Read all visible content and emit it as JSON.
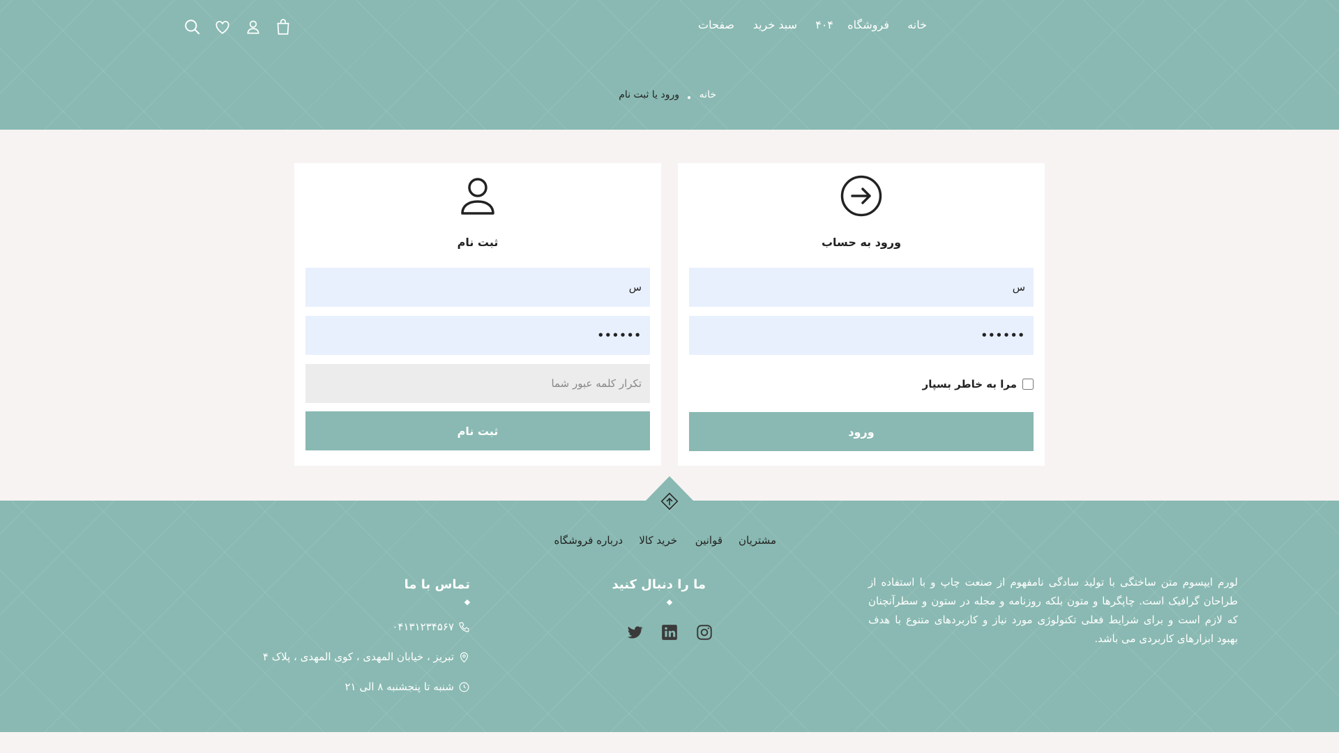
{
  "header": {
    "nav": [
      {
        "label": "خانه"
      },
      {
        "label": "فروشگاه"
      },
      {
        "label": "۴۰۴"
      },
      {
        "label": "سبد خرید"
      },
      {
        "label": "صفحات"
      }
    ],
    "icons": [
      "cart-icon",
      "user-icon",
      "heart-icon",
      "search-icon"
    ]
  },
  "breadcrumb": {
    "home": "خانه",
    "current": "ورود یا ثبت نام"
  },
  "login": {
    "title": "ورود به حساب",
    "username_value": "س",
    "password_value": "••••••",
    "remember_label": "مرا به خاطر بسپار",
    "submit_label": "ورود"
  },
  "register": {
    "title": "ثبت نام",
    "username_value": "س",
    "password_value": "••••••",
    "confirm_placeholder": "تکرار کلمه عبور شما",
    "submit_label": "ثبت نام"
  },
  "footer": {
    "links": [
      {
        "label": "مشتریان"
      },
      {
        "label": "قوانین"
      },
      {
        "label": "خرید کالا"
      },
      {
        "label": "درباره فروشگاه"
      }
    ],
    "about": "لورم ایپسوم متن ساختگی با تولید سادگی نامفهوم از صنعت چاپ و با استفاده از طراحان گرافیک است. چاپگرها و متون بلکه روزنامه و مجله در ستون و سطرآنچنان که لازم است و برای شرایط فعلی تکنولوژی مورد نیاز و کاربردهای متنوع با هدف بهبود ابزارهای کاربردی می باشد.",
    "follow_title": "ما را دنبال کنید",
    "social": [
      "instagram-icon",
      "linkedin-icon",
      "twitter-icon"
    ],
    "contact_title": "تماس با ما",
    "phone": "۰۴۱۳۱۲۳۴۵۶۷",
    "address": "تبریز ، خیابان المهدی ، کوی المهدی ، پلاک ۴",
    "hours": "شنبه تا پنجشنبه ۸ الی ۲۱"
  },
  "colors": {
    "teal": "#89b9b2",
    "page_bg": "#f8f3f3",
    "input_bg": "#e8f0fe"
  }
}
